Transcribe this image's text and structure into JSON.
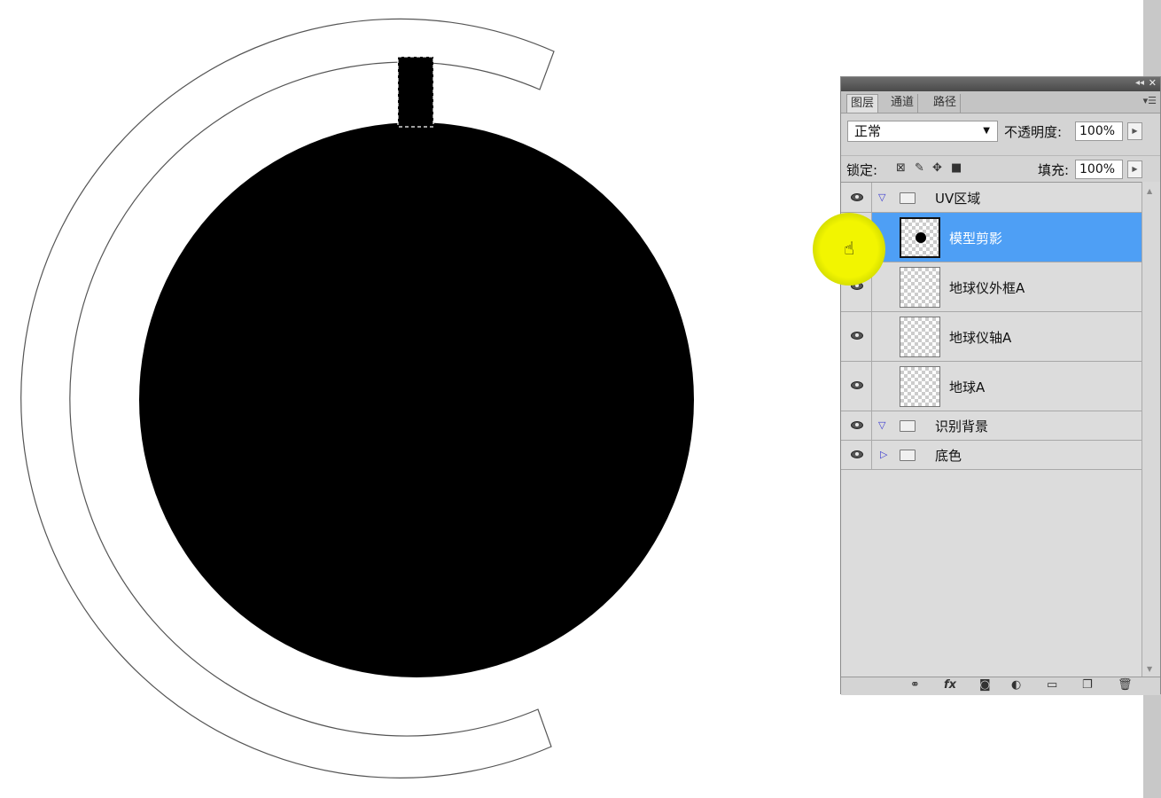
{
  "panel": {
    "tabs": [
      "图层",
      "通道",
      "路径"
    ],
    "blend_mode": "正常",
    "opacity_label": "不透明度:",
    "opacity_value": "100%",
    "lock_label": "锁定:",
    "fill_label": "填充:",
    "fill_value": "100%"
  },
  "layers": [
    {
      "type": "group",
      "name": "UV区域",
      "expanded": true
    },
    {
      "type": "layer",
      "name": "模型剪影",
      "selected": true
    },
    {
      "type": "layer",
      "name": "地球仪外框A"
    },
    {
      "type": "layer",
      "name": "地球仪轴A"
    },
    {
      "type": "layer",
      "name": "地球A"
    },
    {
      "type": "group",
      "name": "识别背景",
      "expanded": true
    },
    {
      "type": "group",
      "name": "底色",
      "expanded": false
    }
  ],
  "colors": {
    "selection": "#4e9ff5",
    "cursor_highlight": "#e8f000",
    "canvas_shape": "#000000"
  },
  "icons": {
    "bottom_bar": [
      "link-icon",
      "fx-icon",
      "mask-icon",
      "adjustment-icon",
      "new-group-icon",
      "new-layer-icon",
      "trash-icon"
    ],
    "locks": [
      "lock-transparency-icon",
      "lock-paint-icon",
      "lock-move-icon",
      "lock-all-icon"
    ]
  }
}
